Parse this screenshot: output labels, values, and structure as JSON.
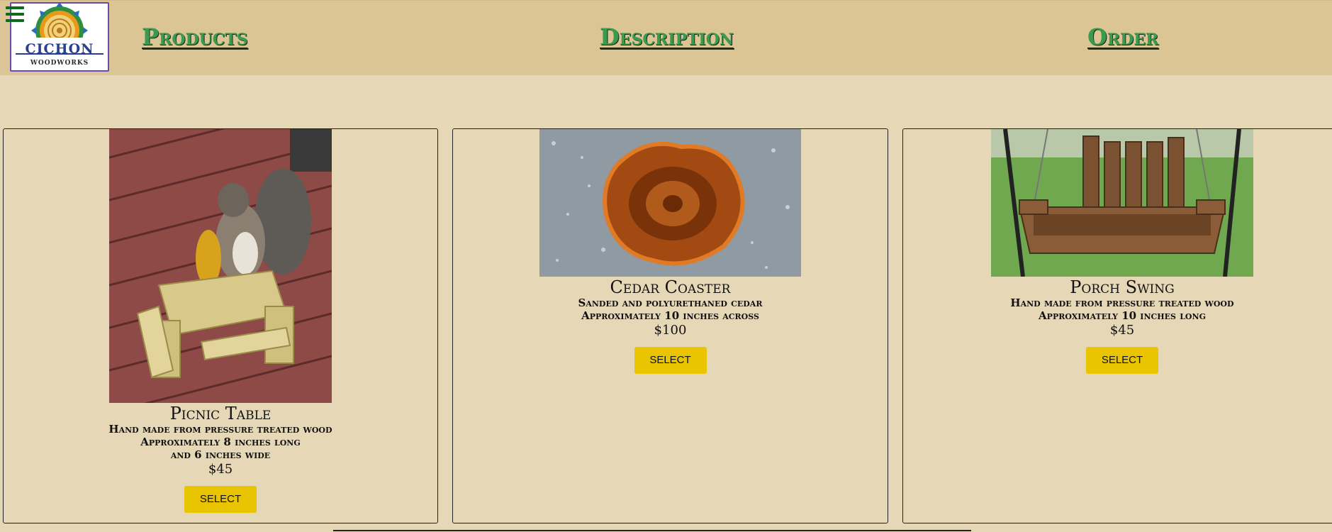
{
  "logo": {
    "line1": "CICHON",
    "line2": "WOODWORKS"
  },
  "nav": {
    "products": "Products",
    "description": "Description",
    "order": "Order"
  },
  "products": [
    {
      "title": "Picnic Table",
      "lines": [
        "Hand made from pressure treated wood",
        "Approximately 8 inches long",
        "and 6 inches wide"
      ],
      "price": "$45",
      "button": "SELECT"
    },
    {
      "title": "Cedar Coaster",
      "lines": [
        "Sanded and polyurethaned cedar",
        "Approximately 10 inches across"
      ],
      "price": "$100",
      "button": "SELECT"
    },
    {
      "title": "Porch Swing",
      "lines": [
        "Hand made from pressure treated wood",
        "Approximately 10 inches long"
      ],
      "price": "$45",
      "button": "SELECT"
    }
  ],
  "colors": {
    "header_bg": "#dcc594",
    "page_bg": "#e6d8b6",
    "nav_link": "#3a9a4d",
    "button": "#e8c500",
    "menu_icon": "#0f6b1f",
    "logo_border": "#6a4bb3"
  },
  "icons": {
    "menu": "hamburger-icon"
  }
}
